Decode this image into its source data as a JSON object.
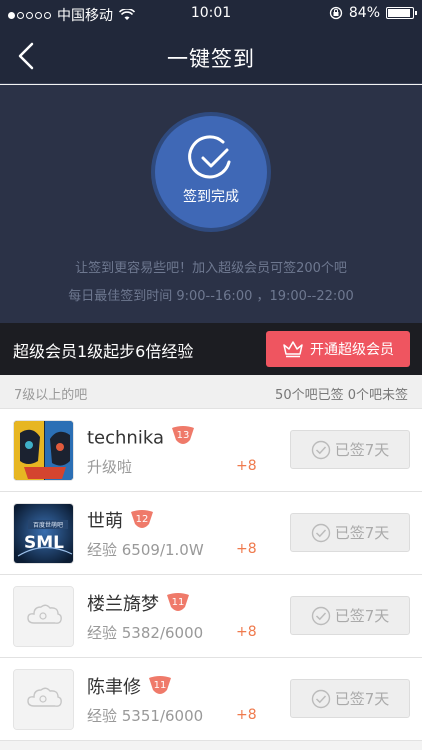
{
  "status": {
    "carrier": "中国移动",
    "time": "10:01",
    "battery": "84%",
    "battery_level": 0.84
  },
  "nav": {
    "title": "一键签到"
  },
  "hero": {
    "done_label": "签到完成",
    "tip1": "让签到更容易些吧！加入超级会员可签200个吧",
    "tip2": "每日最佳签到时间 9:00--16:00 ，19:00--22:00"
  },
  "vip": {
    "text": "超级会员1级起步6倍经验",
    "button_label": "开通超级会员"
  },
  "summary": {
    "left": "7级以上的吧",
    "right": "50个吧已签   0个吧未签"
  },
  "forums": [
    {
      "name": "technika",
      "level": "13",
      "exp": "升级啦",
      "plus": "+8",
      "status": "已签7天",
      "avatar": "technika-avatar"
    },
    {
      "name": "世萌",
      "level": "12",
      "exp": "经验  6509/1.0W",
      "plus": "+8",
      "status": "已签7天",
      "avatar": "sml-avatar"
    },
    {
      "name": "楼兰旖梦",
      "level": "11",
      "exp": "经验  5382/6000",
      "plus": "+8",
      "status": "已签7天",
      "avatar": "placeholder-avatar"
    },
    {
      "name": "陈聿修",
      "level": "11",
      "exp": "经验  5351/6000",
      "plus": "+8",
      "status": "已签7天",
      "avatar": "placeholder-avatar"
    }
  ],
  "colors": {
    "nav_bg": "#21283a",
    "hero_bg": "#2b3247",
    "circle": "#3f68b6",
    "vip_button": "#ef5560",
    "level_badge": "#ef7a6a",
    "plus": "#ef7a4d"
  }
}
